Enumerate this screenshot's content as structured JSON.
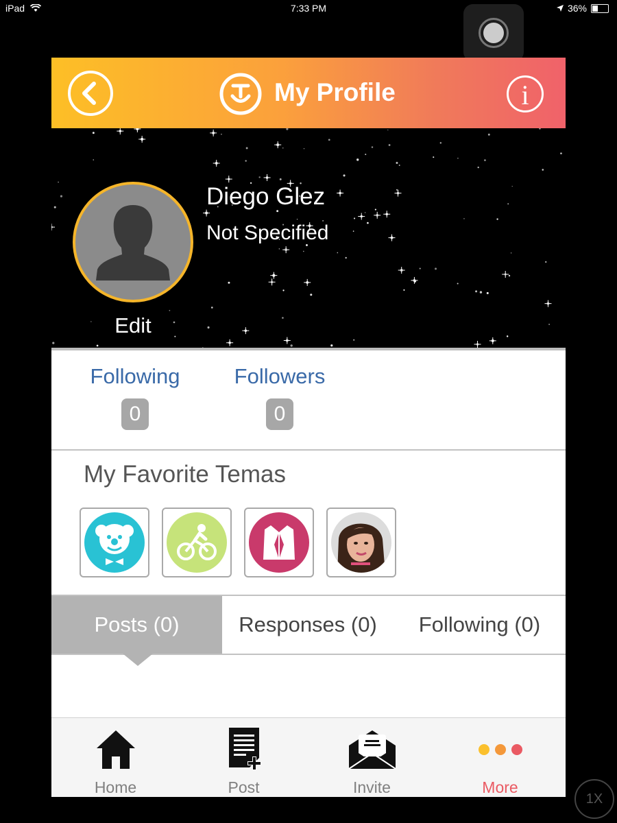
{
  "status_bar": {
    "device": "iPad",
    "time": "7:33 PM",
    "battery": "36%",
    "battery_level": 0.36
  },
  "header": {
    "title": "My Profile",
    "back_icon": "back-arrow-icon",
    "info_icon": "info-icon"
  },
  "profile": {
    "name": "Diego Glez",
    "subtitle": "Not Specified",
    "edit_label": "Edit"
  },
  "stats": {
    "following_label": "Following",
    "following_count": "0",
    "followers_label": "Followers",
    "followers_count": "0"
  },
  "favorites": {
    "title": "My Favorite Temas",
    "items": [
      {
        "icon": "clown-icon",
        "color": "#29c2d4"
      },
      {
        "icon": "cyclist-icon",
        "color": "#c6e37a"
      },
      {
        "icon": "suit-jacket-icon",
        "color": "#c93a6b"
      },
      {
        "icon": "woman-photo-icon",
        "color": "#e8b49a"
      }
    ]
  },
  "tabs": [
    {
      "label": "Posts (0)",
      "active": true
    },
    {
      "label": "Responses (0)",
      "active": false
    },
    {
      "label": "Following (0)",
      "active": false
    }
  ],
  "tab_bar": [
    {
      "label": "Home",
      "icon": "home-icon",
      "active": false
    },
    {
      "label": "Post",
      "icon": "new-post-icon",
      "active": false
    },
    {
      "label": "Invite",
      "icon": "envelope-icon",
      "active": false
    },
    {
      "label": "More",
      "icon": "more-dots-icon",
      "active": true
    }
  ],
  "zoom_badge": "1X",
  "colors": {
    "accent": "#ea5a63",
    "header_start": "#fdbf26",
    "header_end": "#f0626a",
    "link": "#3a6aa8",
    "avatar_ring": "#f5b52a"
  }
}
